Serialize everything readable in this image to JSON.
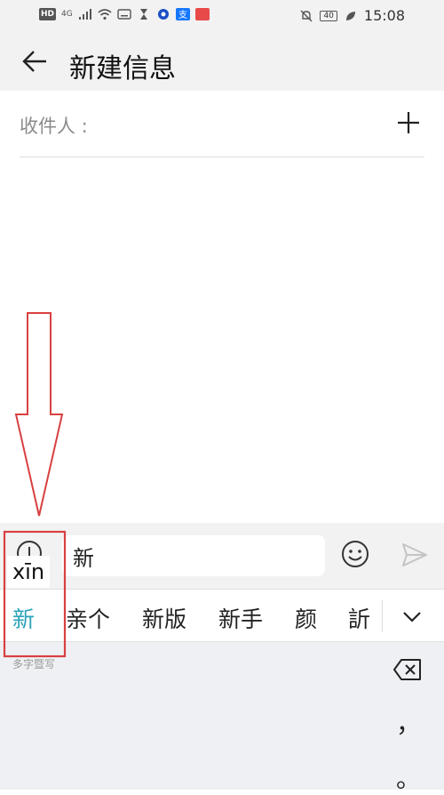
{
  "status_bar": {
    "network_badge": "HD",
    "signal_type": "4G",
    "battery_level": "40",
    "time": "15:08"
  },
  "header": {
    "title": "新建信息"
  },
  "recipient": {
    "label": "收件人 :"
  },
  "compose": {
    "input_value": "新"
  },
  "ime": {
    "pinyin": "xīn",
    "candidates": [
      "新",
      "亲个",
      "新版",
      "新手",
      "颜",
      "訢"
    ],
    "hint": "多字暨写",
    "comma": "，",
    "period": "。"
  },
  "colors": {
    "accent": "#2aa3b8",
    "annotation": "#d94040"
  }
}
